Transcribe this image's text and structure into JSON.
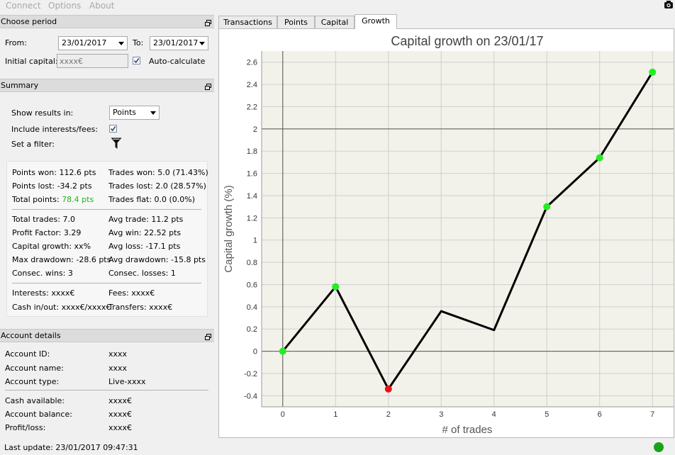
{
  "menu": {
    "items": [
      "Connect",
      "Options",
      "About"
    ]
  },
  "period": {
    "title": "Choose period",
    "from_label": "From:",
    "from_value": "23/01/2017",
    "to_label": "To:",
    "to_value": "23/01/2017",
    "initial_capital_label": "Initial capital:",
    "initial_capital_placeholder": "xxxx€",
    "auto_calculate_label": "Auto-calculate",
    "auto_calculate_checked": true
  },
  "summary": {
    "title": "Summary",
    "show_results_label": "Show results in:",
    "show_results_value": "Points",
    "include_fees_label": "Include interests/fees:",
    "include_fees_checked": true,
    "filter_label": "Set a filter:",
    "stats": {
      "points_won": "Points won: 112.6 pts",
      "trades_won": "Trades won: 5.0 (71.43%)",
      "points_lost": "Points lost: -34.2 pts",
      "trades_lost": "Trades lost: 2.0 (28.57%)",
      "total_points_label": "Total points:",
      "total_points_value": "78.4 pts",
      "total_points_color": "#22b422",
      "trades_flat": "Trades flat: 0.0 (0.0%)",
      "total_trades": "Total trades: 7.0",
      "avg_trade": "Avg trade: 11.2 pts",
      "profit_factor": "Profit Factor: 3.29",
      "avg_win": "Avg win: 22.52 pts",
      "capital_growth": "Capital growth: xx%",
      "avg_loss": "Avg loss: -17.1 pts",
      "max_drawdown": "Max drawdown: -28.6 pts",
      "avg_drawdown": "Avg drawdown: -15.8 pts",
      "consec_wins": "Consec. wins: 3",
      "consec_losses": "Consec. losses: 1",
      "interests": "Interests: xxxx€",
      "fees": "Fees: xxxx€",
      "cash_in_out": "Cash in/out: xxxx€/xxxx€",
      "transfers": "Transfers: xxxx€"
    }
  },
  "account": {
    "title": "Account details",
    "rows": [
      {
        "label": "Account ID:",
        "value": "xxxx"
      },
      {
        "label": "Account name:",
        "value": "xxxx"
      },
      {
        "label": "Account type:",
        "value": "Live-xxxx"
      },
      {
        "label": "Cash available:",
        "value": "xxxx€"
      },
      {
        "label": "Account balance:",
        "value": "xxxx€"
      },
      {
        "label": "Profit/loss:",
        "value": "xxxx€"
      }
    ]
  },
  "status": {
    "last_update": "Last update: 23/01/2017 09:47:31",
    "indicator_color": "#1aa31a"
  },
  "tabs": [
    "Transactions",
    "Points",
    "Capital",
    "Growth"
  ],
  "active_tab": "Growth",
  "icons": {
    "window_float": "float-window-icon",
    "filter": "filter-funnel-icon",
    "camera": "camera-icon"
  },
  "chart_data": {
    "type": "line",
    "title": "Capital growth on 23/01/17",
    "xlabel": "# of trades",
    "ylabel": "Capital growth (%)",
    "x": [
      0,
      1,
      2,
      3,
      4,
      5,
      6,
      7
    ],
    "y": [
      0,
      0.58,
      -0.34,
      0.36,
      0.19,
      1.3,
      1.74,
      2.51
    ],
    "markers": [
      {
        "x": 0,
        "y": 0,
        "color": "#22ee22"
      },
      {
        "x": 1,
        "y": 0.58,
        "color": "#22ee22"
      },
      {
        "x": 2,
        "y": -0.34,
        "color": "#ee1111"
      },
      {
        "x": 5,
        "y": 1.3,
        "color": "#22ee22"
      },
      {
        "x": 6,
        "y": 1.74,
        "color": "#22ee22"
      },
      {
        "x": 7,
        "y": 2.51,
        "color": "#22ee22"
      }
    ],
    "xlim": [
      -0.4,
      7.4
    ],
    "ylim": [
      -0.5,
      2.7
    ],
    "x_ticks": [
      0,
      1,
      2,
      3,
      4,
      5,
      6,
      7
    ],
    "y_ticks": [
      -0.4,
      -0.2,
      0,
      0.2,
      0.4,
      0.6,
      0.8,
      1,
      1.2,
      1.4,
      1.6,
      1.8,
      2,
      2.2,
      2.4,
      2.6
    ],
    "y_tick_labels": [
      "-0.4",
      "-0.2",
      "0",
      "0.2",
      "0.4",
      "0.6",
      "0.8",
      "1",
      "1.2",
      "1.4",
      "1.6",
      "1.8",
      "2",
      "2.2",
      "2.4",
      "2.6"
    ],
    "reference_lines": {
      "x": 0,
      "y": [
        0,
        2
      ]
    },
    "grid": true,
    "line_color": "#000000",
    "plot_background": "#f2f2ea"
  }
}
